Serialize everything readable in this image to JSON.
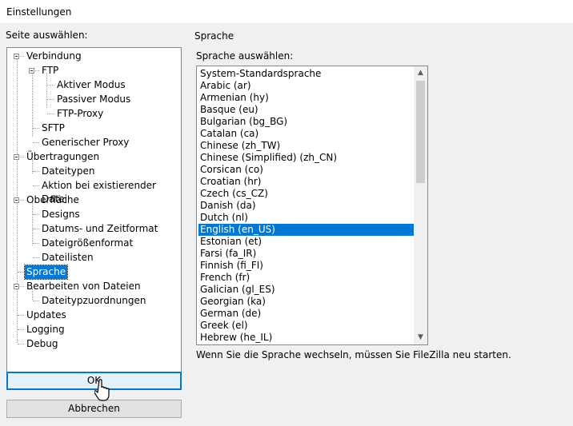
{
  "window": {
    "title": "Einstellungen"
  },
  "tree": {
    "label": "Seite auswählen:",
    "items": [
      {
        "label": "Verbindung",
        "level": 0,
        "expander": true
      },
      {
        "label": "FTP",
        "level": 1,
        "expander": true
      },
      {
        "label": "Aktiver Modus",
        "level": 2
      },
      {
        "label": "Passiver Modus",
        "level": 2
      },
      {
        "label": "FTP-Proxy",
        "level": 2
      },
      {
        "label": "SFTP",
        "level": 1
      },
      {
        "label": "Generischer Proxy",
        "level": 1
      },
      {
        "label": "Übertragungen",
        "level": 0,
        "expander": true
      },
      {
        "label": "Dateitypen",
        "level": 1
      },
      {
        "label": "Aktion bei existierender Datei",
        "level": 1
      },
      {
        "label": "Oberfläche",
        "level": 0,
        "expander": true
      },
      {
        "label": "Designs",
        "level": 1
      },
      {
        "label": "Datums- und Zeitformat",
        "level": 1
      },
      {
        "label": "Dateigrößenformat",
        "level": 1
      },
      {
        "label": "Dateilisten",
        "level": 1
      },
      {
        "label": "Sprache",
        "level": 0,
        "selected": true
      },
      {
        "label": "Bearbeiten von Dateien",
        "level": 0,
        "expander": true
      },
      {
        "label": "Dateitypzuordnungen",
        "level": 1
      },
      {
        "label": "Updates",
        "level": 0
      },
      {
        "label": "Logging",
        "level": 0
      },
      {
        "label": "Debug",
        "level": 0
      }
    ]
  },
  "buttons": {
    "ok": "OK",
    "cancel": "Abbrechen"
  },
  "language_page": {
    "group_title": "Sprache",
    "select_label": "Sprache auswählen:",
    "languages": [
      "System-Standardsprache",
      "Arabic (ar)",
      "Armenian (hy)",
      "Basque (eu)",
      "Bulgarian (bg_BG)",
      "Catalan (ca)",
      "Chinese (zh_TW)",
      "Chinese (Simplified) (zh_CN)",
      "Corsican (co)",
      "Croatian (hr)",
      "Czech (cs_CZ)",
      "Danish (da)",
      "Dutch (nl)",
      "English (en_US)",
      "Estonian (et)",
      "Farsi (fa_IR)",
      "Finnish (fi_FI)",
      "French (fr)",
      "Galician (gl_ES)",
      "Georgian (ka)",
      "German (de)",
      "Greek (el)",
      "Hebrew (he_IL)"
    ],
    "selected_language": "English (en_US)",
    "restart_note": "Wenn Sie die Sprache wechseln, müssen Sie FileZilla neu starten."
  },
  "colors": {
    "selection": "#0078d7",
    "dialog_bg": "#f0f0f0",
    "default_button_border": "#0078d7"
  }
}
